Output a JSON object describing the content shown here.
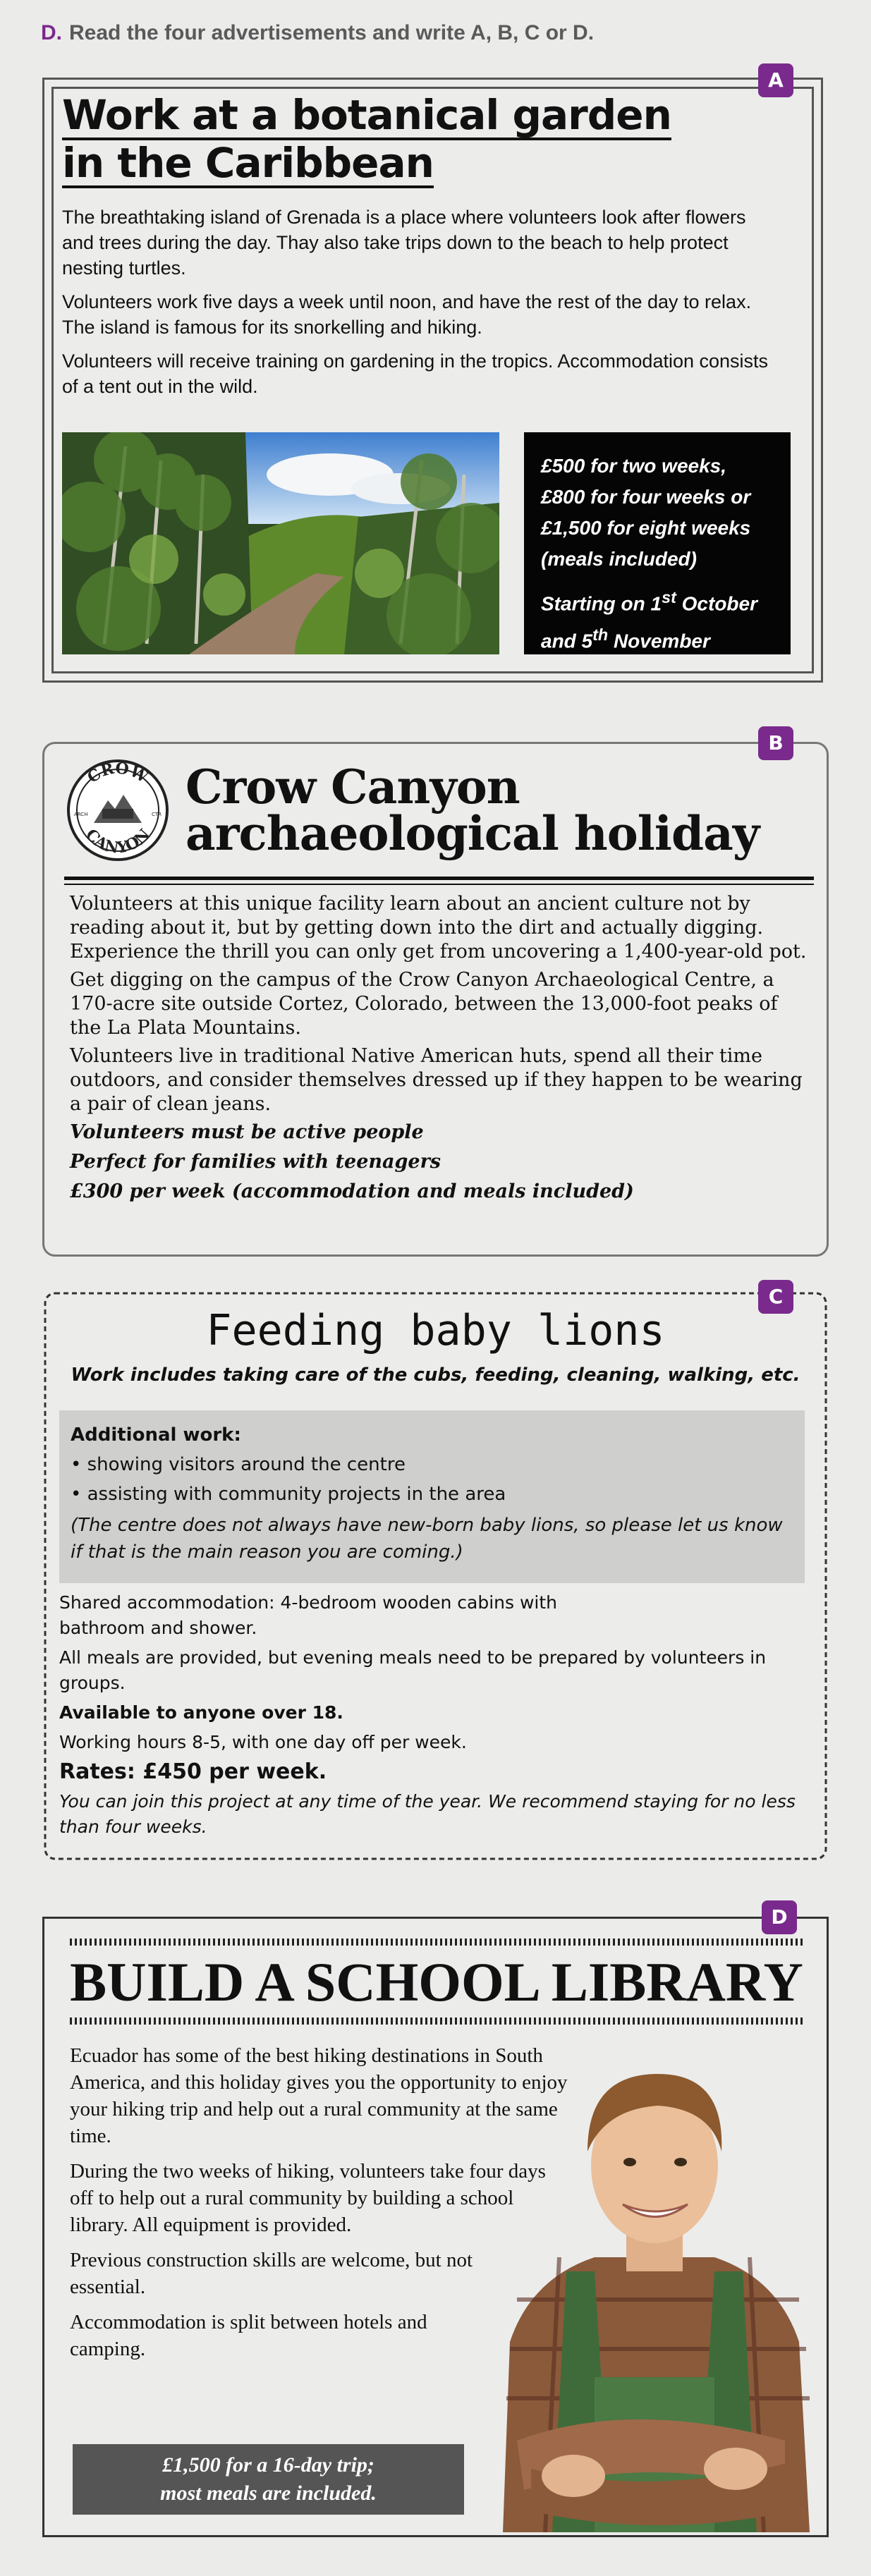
{
  "instruction": {
    "letter": "D.",
    "text": "Read the four advertisements and write A, B, C or D."
  },
  "ad_a": {
    "tag": "A",
    "title_line1": "Work at a botanical garden",
    "title_line2": "in the Caribbean",
    "paragraphs": [
      "The breathtaking island of Grenada is a place where volunteers look after flowers and trees during the day. Thay also take trips down to the beach to help protect nesting turtles.",
      "Volunteers work five days a week until noon, and have the rest of the day to relax. The island is famous for its snorkelling and hiking.",
      "Volunteers will receive training on gardening in the tropics. Accommodation consists of a tent out in the wild."
    ],
    "price_lines": [
      "£500 for two weeks,",
      "£800 for four weeks or",
      "£1,500 for eight weeks",
      "(meals included)"
    ],
    "start_line1_pre": "Starting on 1",
    "start_sup1": "st",
    "start_line1_post": " October",
    "start_line2_pre": "and 5",
    "start_sup2": "th",
    "start_line2_post": " November"
  },
  "ad_b": {
    "tag": "B",
    "logo_top": "CROW",
    "logo_bottom": "CANYON",
    "logo_left": "ARCH",
    "logo_right": "CTR",
    "title_line1": "Crow Canyon",
    "title_line2": "archaeological holiday",
    "paragraphs": [
      "Volunteers at this unique facility learn about an ancient culture not by reading about it, but by getting down into the dirt and actually digging. Experience the thrill you can only get from uncovering a 1,400-year-old pot.",
      "Get digging on the campus of the Crow Canyon Archaeological Centre, a 170-acre site outside Cortez, Colorado, between the 13,000-foot peaks of the La Plata Mountains.",
      "Volunteers live in traditional Native American huts, spend all their time outdoors, and consider themselves dressed up if they happen to be wearing a pair of clean jeans."
    ],
    "highlights": [
      "Volunteers must be active people",
      "Perfect for families with teenagers",
      "£300 per week (accommodation and meals included)"
    ]
  },
  "ad_c": {
    "tag": "C",
    "title": "Feeding baby lions",
    "subtitle": "Work includes taking care of the cubs, feeding, cleaning, walking, etc.",
    "additional_heading": "Additional work:",
    "additional_items": [
      "• showing visitors around the centre",
      "• assisting with community projects in the area"
    ],
    "additional_note": "(The centre does not always have new-born baby lions, so please let us know if that is the main reason you are coming.)",
    "accommodation": "Shared accommodation: 4-bedroom wooden cabins with bathroom and shower.",
    "meals": "All meals are provided, but evening meals need to be prepared by volunteers in groups.",
    "age": "Available to anyone over 18.",
    "hours": "Working hours 8-5, with one day off per week.",
    "rates": "Rates: £450 per week.",
    "join": "You can join this project at any time of the year. We recommend staying for no less than four weeks."
  },
  "ad_d": {
    "tag": "D",
    "title": "BUILD A SCHOOL LIBRARY",
    "paragraphs": [
      "Ecuador has some of the best hiking destinations in South America, and this holiday gives you the opportunity to enjoy your hiking trip and help out a rural community at the same time.",
      "During the two weeks of hiking, volunteers take four days off to help out a rural community by building a school library. All equipment is provided.",
      "Previous construction skills are welcome, but not essential.",
      "Accommodation is split between hotels and camping."
    ],
    "price_line1": "£1,500 for a 16-day trip;",
    "price_line2": "most meals are included."
  },
  "colors": {
    "accent": "#7a2a8c",
    "background": "#ebebea"
  }
}
